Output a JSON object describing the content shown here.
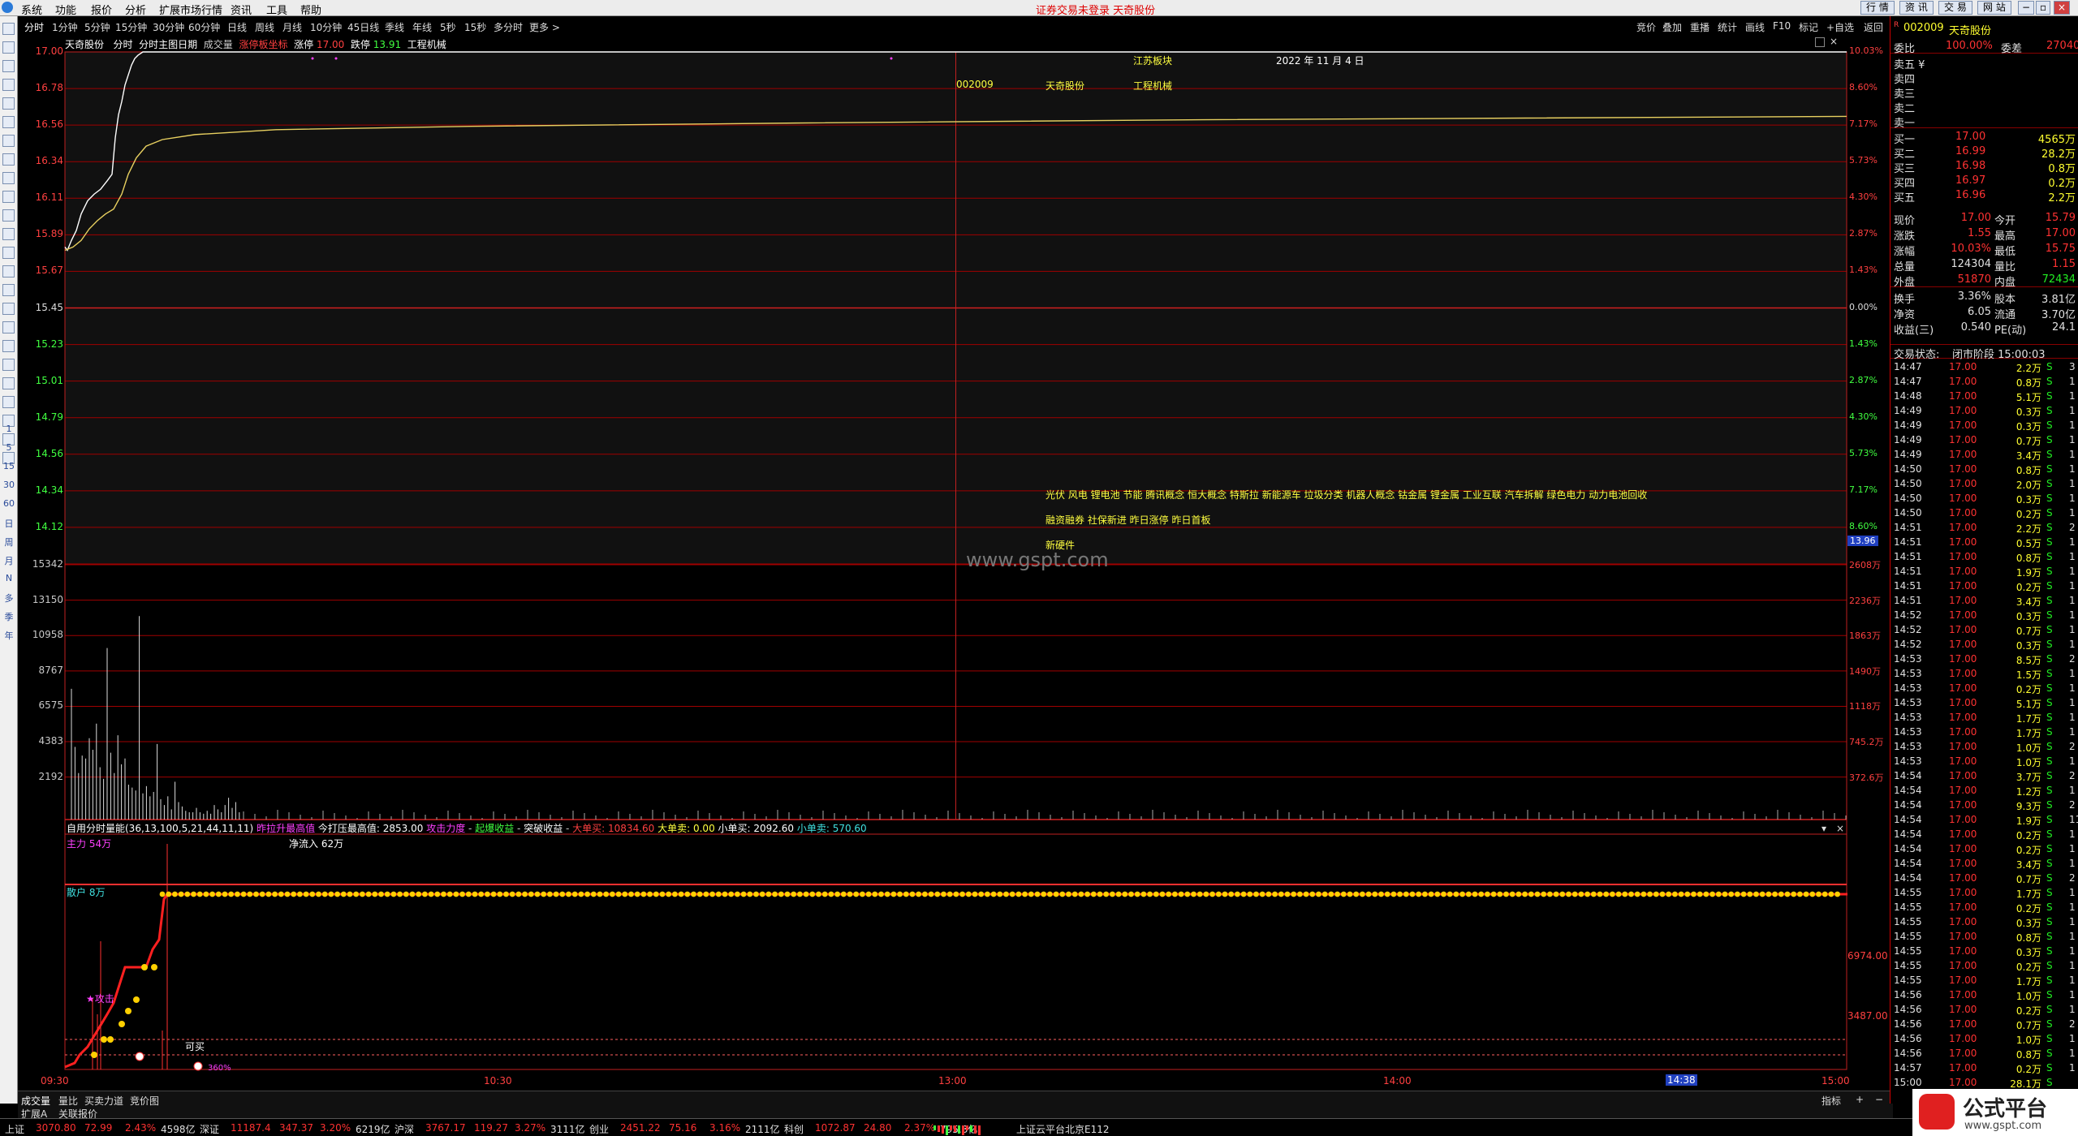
{
  "menu": {
    "items": [
      "系统",
      "功能",
      "报价",
      "分析",
      "扩展市场行情",
      "资讯",
      "工具",
      "帮助"
    ],
    "center_title": "证券交易未登录  天奇股份",
    "right_buttons": [
      "行 情",
      "资 讯",
      "交 易",
      "网 站"
    ]
  },
  "periods": [
    "分时",
    "1分钟",
    "5分钟",
    "15分钟",
    "30分钟",
    "60分钟",
    "日线",
    "周线",
    "月线",
    "10分钟",
    "45日线",
    "季线",
    "年线",
    "5秒",
    "15秒",
    "多分时",
    "更多 >"
  ],
  "top_tools": [
    "竞价",
    "叠加",
    "重播",
    "统计",
    "画线",
    "F10",
    "标记",
    "+自选",
    "返回"
  ],
  "chart_header": {
    "name": "天奇股份",
    "mode": "分时",
    "sub": "分时主图日期",
    "vol": "成交量",
    "limit_tag": "涨停板坐标",
    "limit_up_label": "涨停",
    "limit_up_value": "17.00",
    "limit_down_label": "跌停",
    "limit_down_value": "13.91",
    "sector": "工程机械"
  },
  "annotation": {
    "sector_block": "江苏板块",
    "date": "2022 年 11 月 4 日",
    "code": "002009",
    "name": "天奇股份",
    "industry": "工程机械",
    "concepts_line1": "光伏 风电 锂电池 节能 腾讯概念 恒大概念 特斯拉 新能源车 垃圾分类 机器人概念 钴金属 锂金属 工业互联 汽车拆解 绿色电力 动力电池回收",
    "concepts_line2": "融资融券 社保新进 昨日涨停 昨日首板",
    "concepts_line3": "新硬件",
    "watermark": "www.gspt.com"
  },
  "price_axis_left": [
    "17.00",
    "16.78",
    "16.56",
    "16.34",
    "16.11",
    "15.89",
    "15.67",
    "15.45",
    "15.23",
    "15.01",
    "14.79",
    "14.56",
    "14.34",
    "14.12"
  ],
  "price_axis_right": [
    "10.03%",
    "8.60%",
    "7.17%",
    "5.73%",
    "4.30%",
    "2.87%",
    "1.43%",
    "0.00%",
    "1.43%",
    "2.87%",
    "4.30%",
    "5.73%",
    "7.17%",
    "8.60%"
  ],
  "price_marker": "13.96",
  "vol_axis_left": [
    "15342",
    "13150",
    "10958",
    "8767",
    "6575",
    "4383",
    "2192"
  ],
  "vol_axis_right": [
    "2608万",
    "2236万",
    "1863万",
    "1490万",
    "1118万",
    "745.2万",
    "372.6万"
  ],
  "indicator": {
    "title": "自用分时量能(36,13,100,5,21,44,11,11)",
    "t1": "昨拉升最高值",
    "t2": "今打压最高值: 2853.00",
    "t3": "攻击力度",
    "t4": "起爆收益",
    "t5": "突破收益",
    "t6": "大单买: 10834.60",
    "t7": "大单卖: 0.00",
    "t8": "小单买: 2092.60",
    "t9": "小单卖: 570.60",
    "main_force": "主力 54万",
    "net_inflow": "净流入 62万",
    "retail": "散户 8万",
    "attack": "★攻击",
    "buy": "可买",
    "axis_r1": "6974.00",
    "axis_r2": "3487.00",
    "spark": "360%"
  },
  "time_axis": [
    "09:30",
    "10:30",
    "13:00",
    "14:00",
    "14:38",
    "15:00"
  ],
  "bottom_tabs": [
    "成交量",
    "量比",
    "买卖力道",
    "竞价图"
  ],
  "bottom_tabs2": [
    "扩展A",
    "关联报价"
  ],
  "bottom_right": [
    "指标",
    "+",
    "−"
  ],
  "quote": {
    "code": "002009",
    "name": "天奇股份",
    "wei_bi_label": "委比",
    "wei_bi": "100.00%",
    "wei_cha_label": "委差",
    "wei_cha": "27040",
    "sell5_extra": "卖五 ¥",
    "sells": [
      "卖四",
      "卖三",
      "卖二",
      "卖一"
    ],
    "buys": [
      {
        "label": "买一",
        "price": "17.00",
        "vol": "4565万"
      },
      {
        "label": "买二",
        "price": "16.99",
        "vol": "28.2万"
      },
      {
        "label": "买三",
        "price": "16.98",
        "vol": "0.8万"
      },
      {
        "label": "买四",
        "price": "16.97",
        "vol": "0.2万"
      },
      {
        "label": "买五",
        "price": "16.96",
        "vol": "2.2万"
      }
    ],
    "stats": [
      {
        "l1": "现价",
        "v1": "17.00",
        "l2": "今开",
        "v2": "15.79",
        "c1": "red",
        "c2": "red"
      },
      {
        "l1": "涨跌",
        "v1": "1.55",
        "l2": "最高",
        "v2": "17.00",
        "c1": "red",
        "c2": "red"
      },
      {
        "l1": "涨幅",
        "v1": "10.03%",
        "l2": "最低",
        "v2": "15.75",
        "c1": "red",
        "c2": "red"
      },
      {
        "l1": "总量",
        "v1": "124304",
        "l2": "量比",
        "v2": "1.15",
        "c1": "white",
        "c2": "red"
      },
      {
        "l1": "外盘",
        "v1": "51870",
        "l2": "内盘",
        "v2": "72434",
        "c1": "red",
        "c2": "green"
      },
      {
        "l1": "换手",
        "v1": "3.36%",
        "l2": "股本",
        "v2": "3.81亿",
        "c1": "white",
        "c2": "white"
      },
      {
        "l1": "净资",
        "v1": "6.05",
        "l2": "流通",
        "v2": "3.70亿",
        "c1": "white",
        "c2": "white"
      },
      {
        "l1": "收益(三)",
        "v1": "0.540",
        "l2": "PE(动)",
        "v2": "24.1",
        "c1": "white",
        "c2": "white"
      }
    ],
    "status_label": "交易状态:",
    "status_value": "闭市阶段  15:00:03"
  },
  "ticks": [
    [
      "14:47",
      "17.00",
      "2.2万",
      "S",
      "3"
    ],
    [
      "14:47",
      "17.00",
      "0.8万",
      "S",
      "1"
    ],
    [
      "14:48",
      "17.00",
      "5.1万",
      "S",
      "1"
    ],
    [
      "14:49",
      "17.00",
      "0.3万",
      "S",
      "1"
    ],
    [
      "14:49",
      "17.00",
      "0.3万",
      "S",
      "1"
    ],
    [
      "14:49",
      "17.00",
      "0.7万",
      "S",
      "1"
    ],
    [
      "14:49",
      "17.00",
      "3.4万",
      "S",
      "1"
    ],
    [
      "14:50",
      "17.00",
      "0.8万",
      "S",
      "1"
    ],
    [
      "14:50",
      "17.00",
      "2.0万",
      "S",
      "1"
    ],
    [
      "14:50",
      "17.00",
      "0.3万",
      "S",
      "1"
    ],
    [
      "14:50",
      "17.00",
      "0.2万",
      "S",
      "1"
    ],
    [
      "14:51",
      "17.00",
      "2.2万",
      "S",
      "2"
    ],
    [
      "14:51",
      "17.00",
      "0.5万",
      "S",
      "1"
    ],
    [
      "14:51",
      "17.00",
      "0.8万",
      "S",
      "1"
    ],
    [
      "14:51",
      "17.00",
      "1.9万",
      "S",
      "1"
    ],
    [
      "14:51",
      "17.00",
      "0.2万",
      "S",
      "1"
    ],
    [
      "14:51",
      "17.00",
      "3.4万",
      "S",
      "1"
    ],
    [
      "14:52",
      "17.00",
      "0.3万",
      "S",
      "1"
    ],
    [
      "14:52",
      "17.00",
      "0.7万",
      "S",
      "1"
    ],
    [
      "14:52",
      "17.00",
      "0.3万",
      "S",
      "1"
    ],
    [
      "14:53",
      "17.00",
      "8.5万",
      "S",
      "2"
    ],
    [
      "14:53",
      "17.00",
      "1.5万",
      "S",
      "1"
    ],
    [
      "14:53",
      "17.00",
      "0.2万",
      "S",
      "1"
    ],
    [
      "14:53",
      "17.00",
      "5.1万",
      "S",
      "1"
    ],
    [
      "14:53",
      "17.00",
      "1.7万",
      "S",
      "1"
    ],
    [
      "14:53",
      "17.00",
      "1.7万",
      "S",
      "1"
    ],
    [
      "14:53",
      "17.00",
      "1.0万",
      "S",
      "2"
    ],
    [
      "14:53",
      "17.00",
      "1.0万",
      "S",
      "1"
    ],
    [
      "14:54",
      "17.00",
      "3.7万",
      "S",
      "2"
    ],
    [
      "14:54",
      "17.00",
      "1.2万",
      "S",
      "1"
    ],
    [
      "14:54",
      "17.00",
      "9.3万",
      "S",
      "2"
    ],
    [
      "14:54",
      "17.00",
      "1.9万",
      "S",
      "11"
    ],
    [
      "14:54",
      "17.00",
      "0.2万",
      "S",
      "1"
    ],
    [
      "14:54",
      "17.00",
      "0.2万",
      "S",
      "1"
    ],
    [
      "14:54",
      "17.00",
      "3.4万",
      "S",
      "1"
    ],
    [
      "14:54",
      "17.00",
      "0.7万",
      "S",
      "2"
    ],
    [
      "14:55",
      "17.00",
      "1.7万",
      "S",
      "1"
    ],
    [
      "14:55",
      "17.00",
      "0.2万",
      "S",
      "1"
    ],
    [
      "14:55",
      "17.00",
      "0.3万",
      "S",
      "1"
    ],
    [
      "14:55",
      "17.00",
      "0.8万",
      "S",
      "1"
    ],
    [
      "14:55",
      "17.00",
      "0.3万",
      "S",
      "1"
    ],
    [
      "14:55",
      "17.00",
      "0.2万",
      "S",
      "1"
    ],
    [
      "14:55",
      "17.00",
      "1.7万",
      "S",
      "1"
    ],
    [
      "14:56",
      "17.00",
      "1.0万",
      "S",
      "1"
    ],
    [
      "14:56",
      "17.00",
      "0.2万",
      "S",
      "1"
    ],
    [
      "14:56",
      "17.00",
      "0.7万",
      "S",
      "2"
    ],
    [
      "14:56",
      "17.00",
      "1.0万",
      "S",
      "1"
    ],
    [
      "14:56",
      "17.00",
      "0.8万",
      "S",
      "1"
    ],
    [
      "14:57",
      "17.00",
      "0.2万",
      "S",
      "1"
    ],
    [
      "15:00",
      "17.00",
      "28.1万",
      "S",
      ""
    ]
  ],
  "statusbar": [
    {
      "name": "上证",
      "v": "3070.80",
      "c": "72.99",
      "p": "2.43%",
      "a": "4598亿"
    },
    {
      "name": "深证",
      "v": "11187.4",
      "c": "347.37",
      "p": "3.20%",
      "a": "6219亿"
    },
    {
      "name": "沪深",
      "v": "3767.17",
      "c": "119.27",
      "p": "3.27%",
      "a": "3111亿"
    },
    {
      "name": "创业",
      "v": "2451.22",
      "c": "75.16",
      "p": "3.16%",
      "a": "2111亿"
    },
    {
      "name": "科创",
      "v": "1072.87",
      "c": "24.80",
      "p": "2.37%",
      "a": "795.3亿"
    }
  ],
  "server": "上证云平台北京E112",
  "logo_text": "公式平台",
  "logo_url": "www.gspt.com",
  "colors": {
    "up": "#ff3232",
    "down": "#22ee22",
    "price_line": "#ffffff",
    "avg_line": "#e8d060",
    "grid": "#a00000",
    "dot": "#ffd000"
  }
}
